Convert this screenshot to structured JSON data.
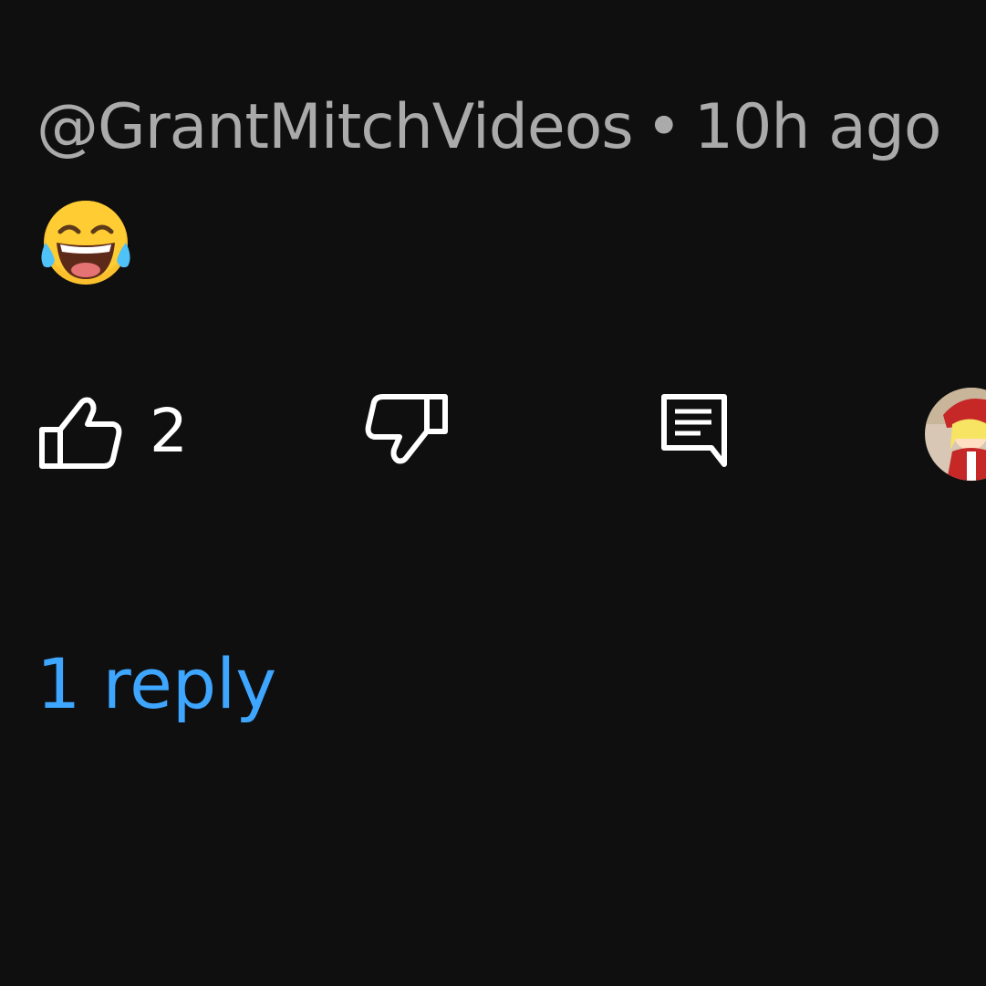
{
  "comment": {
    "author": "@GrantMitchVideos",
    "separator": "•",
    "timestamp": "10h ago",
    "body_emoji": "face-with-tears-of-joy"
  },
  "actions": {
    "like_icon": "thumbs-up-icon",
    "like_count": "2",
    "dislike_icon": "thumbs-down-icon",
    "reply_icon": "comment-icon",
    "creator_avatar": "avatar"
  },
  "replies": {
    "label": "1 reply"
  },
  "colors": {
    "background": "#0f0f0f",
    "meta_text": "#aaaaaa",
    "icon": "#ffffff",
    "link": "#3ea6ff"
  }
}
